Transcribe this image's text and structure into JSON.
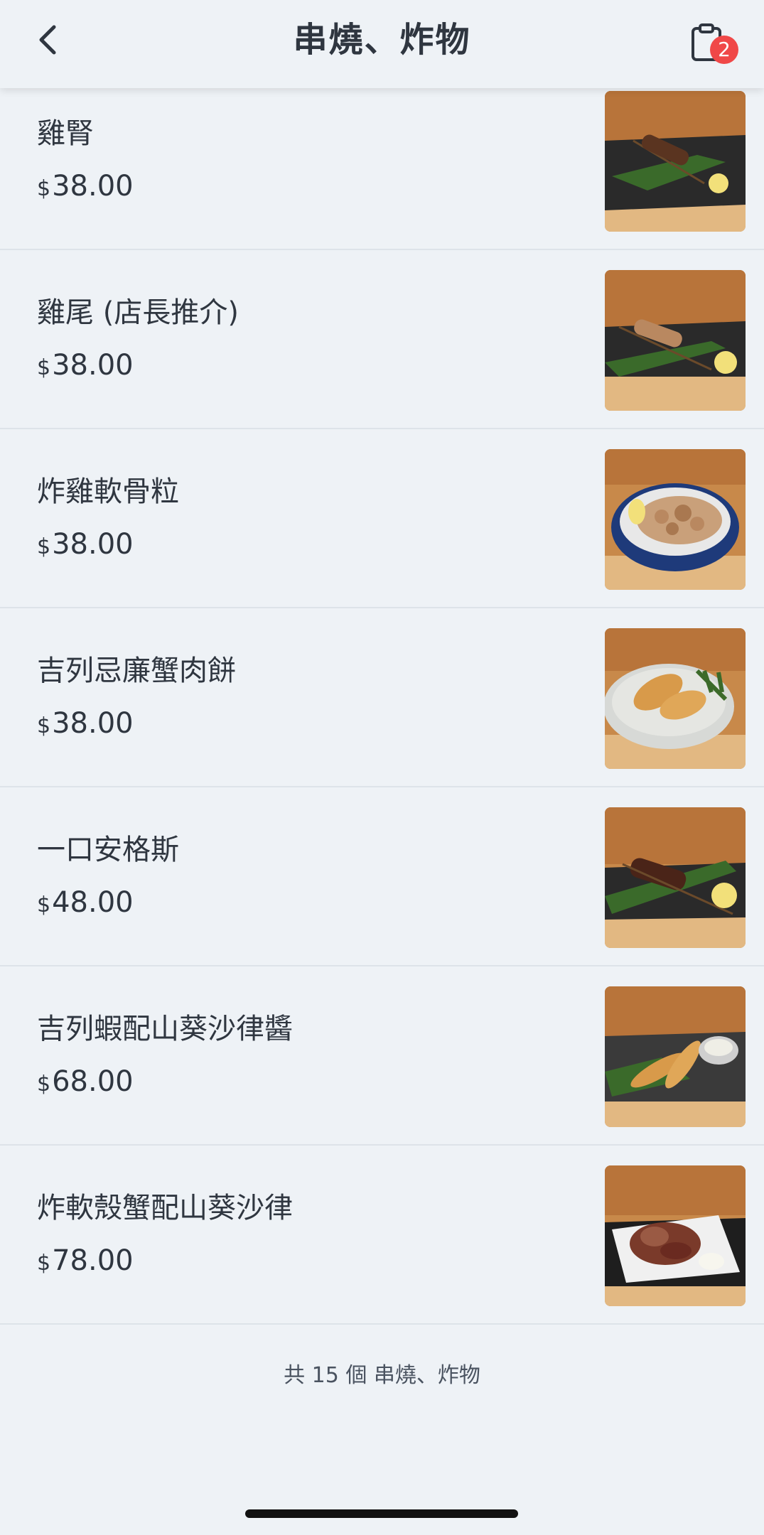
{
  "header": {
    "title": "串燒、炸物",
    "cart_count": "2"
  },
  "items": [
    {
      "name": "雞腎",
      "currency": "$",
      "price": "38.00",
      "image": "skewer-on-leaf-photo"
    },
    {
      "name": "雞尾 (店長推介)",
      "currency": "$",
      "price": "38.00",
      "image": "skewer-on-leaf-photo"
    },
    {
      "name": "炸雞軟骨粒",
      "currency": "$",
      "price": "38.00",
      "image": "fried-bites-bowl-photo"
    },
    {
      "name": "吉列忌廉蟹肉餅",
      "currency": "$",
      "price": "38.00",
      "image": "croquette-plate-photo"
    },
    {
      "name": "一口安格斯",
      "currency": "$",
      "price": "48.00",
      "image": "beef-skewer-photo"
    },
    {
      "name": "吉列蝦配山葵沙律醬",
      "currency": "$",
      "price": "68.00",
      "image": "fried-shrimp-photo"
    },
    {
      "name": "炸軟殼蟹配山葵沙律",
      "currency": "$",
      "price": "78.00",
      "image": "soft-shell-crab-photo"
    }
  ],
  "footer": {
    "count_text": "共 15 個 串燒、炸物"
  },
  "colors": {
    "background": "#eef2f6",
    "text": "#2f3640",
    "badge": "#f04848",
    "divider": "#dde3e9"
  }
}
